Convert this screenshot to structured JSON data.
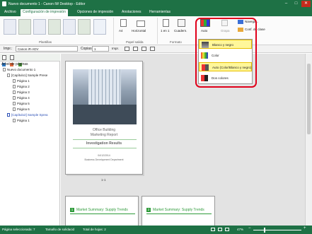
{
  "window": {
    "title": "Nuevo documento 1 - Canon iW Desktop - Editor",
    "min": "–",
    "max": "□",
    "close": "✕"
  },
  "tabs": [
    "Archivo",
    "Configuración de impresión",
    "Opciones de impresión",
    "Anotaciones",
    "Herramientas"
  ],
  "ribbon": {
    "groups": {
      "plantillas": "Plantillas",
      "papel": "Papel salida",
      "formato": "Formato"
    },
    "size_value": "A4",
    "orientation": "Horizontal",
    "nup": "1 en 1",
    "binding": "Cuadern.",
    "color_label": "Auto",
    "grapa_label": "Grapa",
    "nav": "Navega...",
    "conf": "Conf. de clase"
  },
  "toolbar": {
    "printer_label": "Impr.:",
    "printer_value": "Canon iR-ADV",
    "copies_label": "Copias:",
    "copies_value": "1",
    "print_button": "Impr."
  },
  "tree": {
    "title": "Árbol de páginas",
    "root": "Nuevo documento 1",
    "ch1": "[Capítulo1] Sample Prese",
    "pages": [
      "Página 1",
      "Página 2",
      "Página 3",
      "Página 4",
      "Página 5",
      "Página 6"
    ],
    "ch2": "[Capítulo2] Sample Sprea",
    "ch2_page": "Página 1"
  },
  "preview": {
    "title1": "Office Building",
    "title2": "Marketing Report",
    "subtitle": "Investigation Results",
    "date": "04/12/2014",
    "dept": "Business Development Department",
    "label": "1-1",
    "p2_num": "1",
    "p2_title": "Market Summary: Supply Trends",
    "p3_num": "2",
    "p3_title": "Market Summary: Supply Trends"
  },
  "dropdown": {
    "items": [
      "Blanco y negro",
      "Color",
      "Auto (Color/Blanco y negro)",
      "Dos colores"
    ],
    "selected": "Auto (Color/Blanco y negro)"
  },
  "status": {
    "selected": "Página seleccionada: 7",
    "binding": "Tamaño de solidacid",
    "total": "Total de hojas: 2",
    "zoom": "47%"
  },
  "colors": {
    "accent": "#1e7145",
    "highlight": "#e0001a",
    "selected": "#fff79a"
  }
}
